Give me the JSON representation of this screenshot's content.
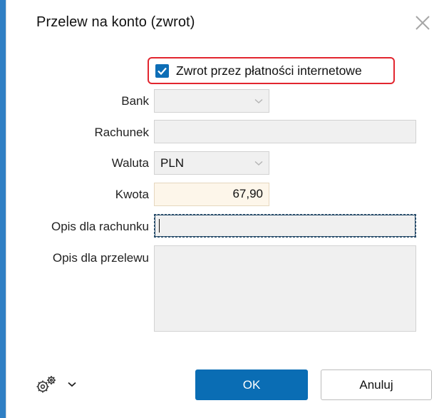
{
  "dialog": {
    "title": "Przelew na konto (zwrot)",
    "close_icon": "close-icon"
  },
  "online_payment": {
    "label": "Zwrot przez płatności internetowe",
    "checked": true
  },
  "form": {
    "bank": {
      "label": "Bank",
      "value": ""
    },
    "account": {
      "label": "Rachunek",
      "value": ""
    },
    "currency": {
      "label": "Waluta",
      "value": "PLN"
    },
    "amount": {
      "label": "Kwota",
      "value": "67,90"
    },
    "account_description": {
      "label": "Opis dla rachunku",
      "value": ""
    },
    "transfer_description": {
      "label": "Opis dla przelewu",
      "value": ""
    }
  },
  "footer": {
    "settings_icon": "gears-icon",
    "ok_label": "OK",
    "cancel_label": "Anuluj"
  },
  "colors": {
    "accent": "#0a6db4",
    "highlight_border": "#e2262f",
    "amount_bg": "#fdf6ea"
  }
}
